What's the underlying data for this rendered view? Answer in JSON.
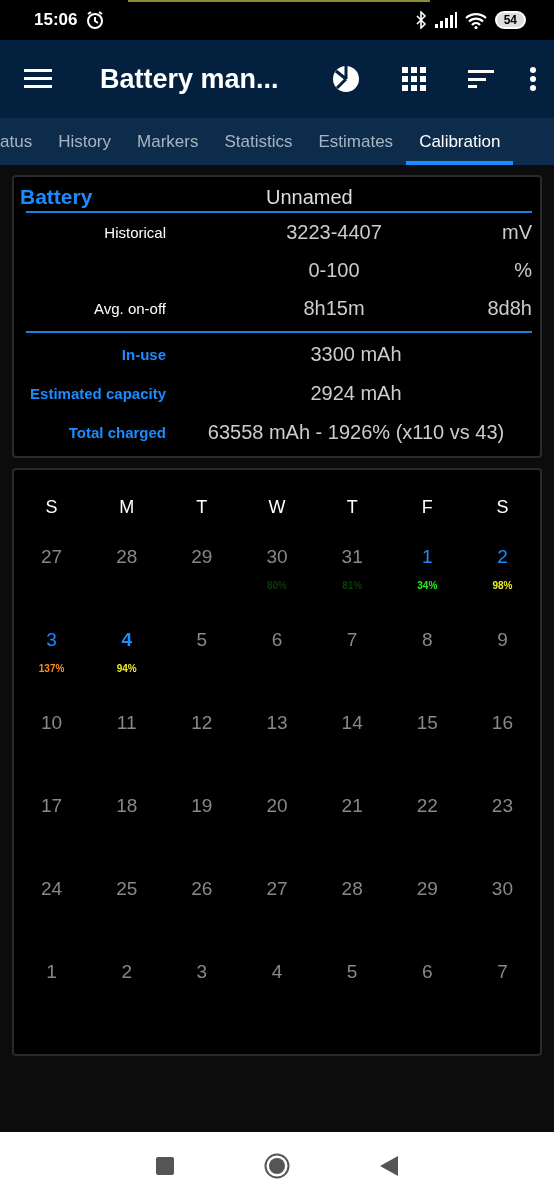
{
  "status_bar": {
    "time": "15:06",
    "battery": "54"
  },
  "app_bar": {
    "title": "Battery man..."
  },
  "tabs": [
    {
      "label": "atus",
      "selected": false
    },
    {
      "label": "History",
      "selected": false
    },
    {
      "label": "Markers",
      "selected": false
    },
    {
      "label": "Statistics",
      "selected": false
    },
    {
      "label": "Estimates",
      "selected": false
    },
    {
      "label": "Calibration",
      "selected": true
    }
  ],
  "battery_card": {
    "title": "Battery",
    "name": "Unnamed",
    "ranges": [
      {
        "label": "Historical",
        "value": "3223-4407",
        "unit": "mV"
      },
      {
        "value": "0-100",
        "unit": "%"
      },
      {
        "label": "Avg. on-off",
        "value": "8h15m",
        "unit": "8d8h"
      }
    ],
    "capacities": [
      {
        "label": "In-use",
        "value": "3300 mAh"
      },
      {
        "label": "Estimated capacity",
        "value": "2924 mAh"
      },
      {
        "label": "Total charged",
        "value": "63558 mAh - 1926% (x110 vs 43)"
      }
    ]
  },
  "calendar": {
    "weekdays": [
      "S",
      "M",
      "T",
      "W",
      "T",
      "F",
      "S"
    ],
    "weeks": [
      [
        {
          "day": "27",
          "highlighted": false,
          "today": false
        },
        {
          "day": "28",
          "highlighted": false,
          "today": false
        },
        {
          "day": "29",
          "highlighted": false,
          "today": false
        },
        {
          "day": "30",
          "highlighted": false,
          "today": false,
          "percent": "80%",
          "color": "#0b3a0b"
        },
        {
          "day": "31",
          "highlighted": false,
          "today": false,
          "percent": "81%",
          "color": "#0b3a0b"
        },
        {
          "day": "1",
          "highlighted": true,
          "today": false,
          "percent": "34%",
          "color": "#22ee22"
        },
        {
          "day": "2",
          "highlighted": true,
          "today": false,
          "percent": "98%",
          "color": "#eeee22"
        }
      ],
      [
        {
          "day": "3",
          "highlighted": true,
          "today": false,
          "percent": "137%",
          "color": "#ff8c1a"
        },
        {
          "day": "4",
          "highlighted": true,
          "today": true,
          "percent": "94%",
          "color": "#eeee22"
        },
        {
          "day": "5",
          "highlighted": false,
          "today": false
        },
        {
          "day": "6",
          "highlighted": false,
          "today": false
        },
        {
          "day": "7",
          "highlighted": false,
          "today": false
        },
        {
          "day": "8",
          "highlighted": false,
          "today": false
        },
        {
          "day": "9",
          "highlighted": false,
          "today": false
        }
      ],
      [
        {
          "day": "10",
          "highlighted": false,
          "today": false
        },
        {
          "day": "11",
          "highlighted": false,
          "today": false
        },
        {
          "day": "12",
          "highlighted": false,
          "today": false
        },
        {
          "day": "13",
          "highlighted": false,
          "today": false
        },
        {
          "day": "14",
          "highlighted": false,
          "today": false
        },
        {
          "day": "15",
          "highlighted": false,
          "today": false
        },
        {
          "day": "16",
          "highlighted": false,
          "today": false
        }
      ],
      [
        {
          "day": "17",
          "highlighted": false,
          "today": false
        },
        {
          "day": "18",
          "highlighted": false,
          "today": false
        },
        {
          "day": "19",
          "highlighted": false,
          "today": false
        },
        {
          "day": "20",
          "highlighted": false,
          "today": false
        },
        {
          "day": "21",
          "highlighted": false,
          "today": false
        },
        {
          "day": "22",
          "highlighted": false,
          "today": false
        },
        {
          "day": "23",
          "highlighted": false,
          "today": false
        }
      ],
      [
        {
          "day": "24",
          "highlighted": false,
          "today": false
        },
        {
          "day": "25",
          "highlighted": false,
          "today": false
        },
        {
          "day": "26",
          "highlighted": false,
          "today": false
        },
        {
          "day": "27",
          "highlighted": false,
          "today": false
        },
        {
          "day": "28",
          "highlighted": false,
          "today": false
        },
        {
          "day": "29",
          "highlighted": false,
          "today": false
        },
        {
          "day": "30",
          "highlighted": false,
          "today": false
        }
      ],
      [
        {
          "day": "1",
          "highlighted": false,
          "today": false
        },
        {
          "day": "2",
          "highlighted": false,
          "today": false
        },
        {
          "day": "3",
          "highlighted": false,
          "today": false
        },
        {
          "day": "4",
          "highlighted": false,
          "today": false
        },
        {
          "day": "5",
          "highlighted": false,
          "today": false
        },
        {
          "day": "6",
          "highlighted": false,
          "today": false
        },
        {
          "day": "7",
          "highlighted": false,
          "today": false
        }
      ]
    ]
  }
}
